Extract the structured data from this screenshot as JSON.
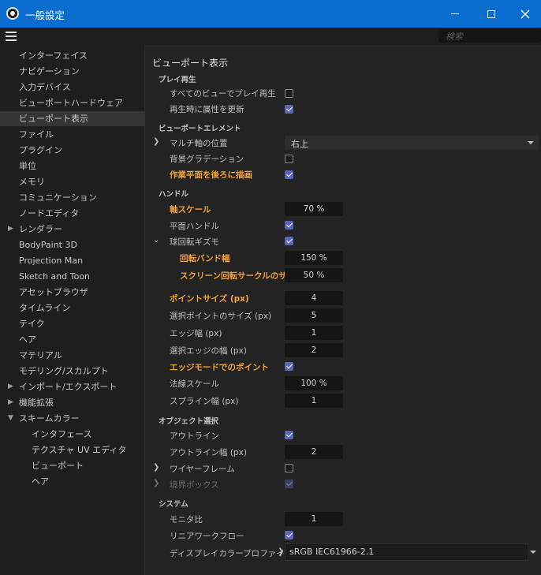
{
  "window": {
    "title": "一般設定"
  },
  "search": {
    "placeholder": "検索"
  },
  "sidebar": {
    "items": [
      "インターフェイス",
      "ナビゲーション",
      "入力デバイス",
      "ビューポートハードウェア",
      "ビューポート表示",
      "ファイル",
      "プラグイン",
      "単位",
      "メモリ",
      "コミュニケーション",
      "ノードエディタ",
      "レンダラー",
      "BodyPaint 3D",
      "Projection Man",
      "Sketch and Toon",
      "アセットブラウザ",
      "タイムライン",
      "テイク",
      "ヘア",
      "マテリアル",
      "モデリング/スカルプト",
      "インポート/エクスポート",
      "機能拡張",
      "スキームカラー"
    ],
    "sub_items": [
      "インタフェース",
      "テクスチャ UV エディタ",
      "ビューポート",
      "ヘア"
    ]
  },
  "content": {
    "title": "ビューポート表示",
    "play": {
      "header": "プレイ再生",
      "all_views": "すべてのビューでプレイ再生",
      "update_attr": "再生時に属性を更新"
    },
    "viewport_element": {
      "header": "ビューポートエレメント",
      "multi_axis": "マルチ軸の位置",
      "multi_axis_value": "右上",
      "bg_gradient": "背景グラデーション",
      "workplane_behind": "作業平面を後ろに描画"
    },
    "handles": {
      "header": "ハンドル",
      "axis_scale": "軸スケール",
      "axis_scale_value": "70 %",
      "plane_handle": "平面ハンドル",
      "sphere_gizmo": "球回転ギズモ",
      "rotation_band": "回転バンド幅",
      "rotation_band_value": "150 %",
      "screen_circle": "スクリーン回転サークルのサイズ",
      "screen_circle_value": "50 %",
      "point_size": "ポイントサイズ (px)",
      "point_size_value": "4",
      "sel_point_size": "選択ポイントのサイズ (px)",
      "sel_point_size_value": "5",
      "edge_width": "エッジ幅 (px)",
      "edge_width_value": "1",
      "sel_edge_width": "選択エッジの幅 (px)",
      "sel_edge_width_value": "2",
      "edge_mode_points": "エッジモードでのポイント",
      "normal_scale": "法線スケール",
      "normal_scale_value": "100 %",
      "spline_width": "スプライン幅 (px)",
      "spline_width_value": "1"
    },
    "object_selection": {
      "header": "オブジェクト選択",
      "outline": "アウトライン",
      "outline_width": "アウトライン幅 (px)",
      "outline_width_value": "2",
      "wireframe": "ワイヤーフレーム",
      "bounding_box": "境界ボックス"
    },
    "system": {
      "header": "システム",
      "monitor_ratio": "モニタ比",
      "monitor_ratio_value": "1",
      "linear_workflow": "リニアワークフロー",
      "display_profile": "ディスプレイカラープロファイル",
      "display_profile_value": "sRGB IEC61966-2.1"
    }
  },
  "colors": {
    "titlebar": "#0c6dd0",
    "accent": "#5a67b5",
    "highlight": "#f2a23c"
  }
}
